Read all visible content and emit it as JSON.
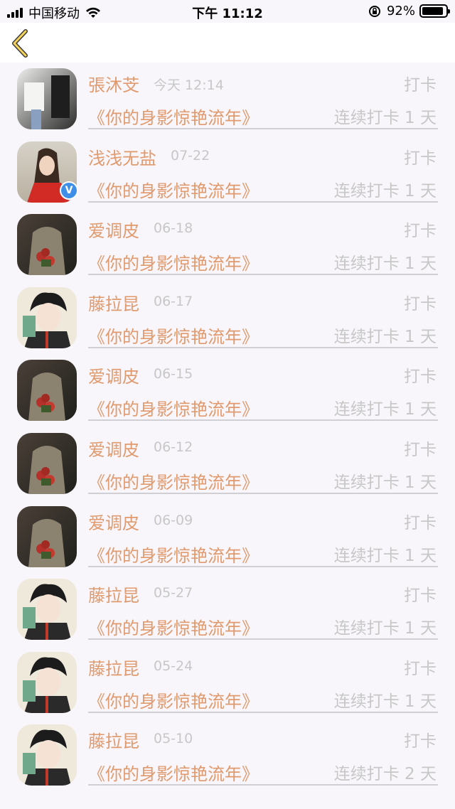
{
  "status_bar": {
    "carrier": "中国移动",
    "time": "下午 11:12",
    "battery": "92%",
    "battery_level": 0.92
  },
  "colors": {
    "accent": "#e09a6e",
    "muted": "#c7c7c7",
    "background": "#f8f6fa",
    "verified": "#3f8ee8"
  },
  "icons": {
    "back": "chevron-left-icon",
    "verified": "verified-badge-icon"
  },
  "records": [
    {
      "user": "張沐芠",
      "date": "今天 12:14",
      "action": "打卡",
      "title": "《你的身影惊艳流年》",
      "streak": "连续打卡 1 天",
      "avatar": "avatar-a",
      "verified": false
    },
    {
      "user": "浅浅无盐",
      "date": "07-22",
      "action": "打卡",
      "title": "《你的身影惊艳流年》",
      "streak": "连续打卡 1 天",
      "avatar": "avatar-b",
      "verified": true
    },
    {
      "user": "爱调皮",
      "date": "06-18",
      "action": "打卡",
      "title": "《你的身影惊艳流年》",
      "streak": "连续打卡 1 天",
      "avatar": "avatar-c",
      "verified": false
    },
    {
      "user": "藤拉昆",
      "date": "06-17",
      "action": "打卡",
      "title": "《你的身影惊艳流年》",
      "streak": "连续打卡 1 天",
      "avatar": "avatar-d",
      "verified": false
    },
    {
      "user": "爱调皮",
      "date": "06-15",
      "action": "打卡",
      "title": "《你的身影惊艳流年》",
      "streak": "连续打卡 1 天",
      "avatar": "avatar-c",
      "verified": false
    },
    {
      "user": "爱调皮",
      "date": "06-12",
      "action": "打卡",
      "title": "《你的身影惊艳流年》",
      "streak": "连续打卡 1 天",
      "avatar": "avatar-c",
      "verified": false
    },
    {
      "user": "爱调皮",
      "date": "06-09",
      "action": "打卡",
      "title": "《你的身影惊艳流年》",
      "streak": "连续打卡 1 天",
      "avatar": "avatar-c",
      "verified": false
    },
    {
      "user": "藤拉昆",
      "date": "05-27",
      "action": "打卡",
      "title": "《你的身影惊艳流年》",
      "streak": "连续打卡 1 天",
      "avatar": "avatar-d",
      "verified": false
    },
    {
      "user": "藤拉昆",
      "date": "05-24",
      "action": "打卡",
      "title": "《你的身影惊艳流年》",
      "streak": "连续打卡 1 天",
      "avatar": "avatar-d",
      "verified": false
    },
    {
      "user": "藤拉昆",
      "date": "05-10",
      "action": "打卡",
      "title": "《你的身影惊艳流年》",
      "streak": "连续打卡 2 天",
      "avatar": "avatar-d",
      "verified": false
    }
  ]
}
